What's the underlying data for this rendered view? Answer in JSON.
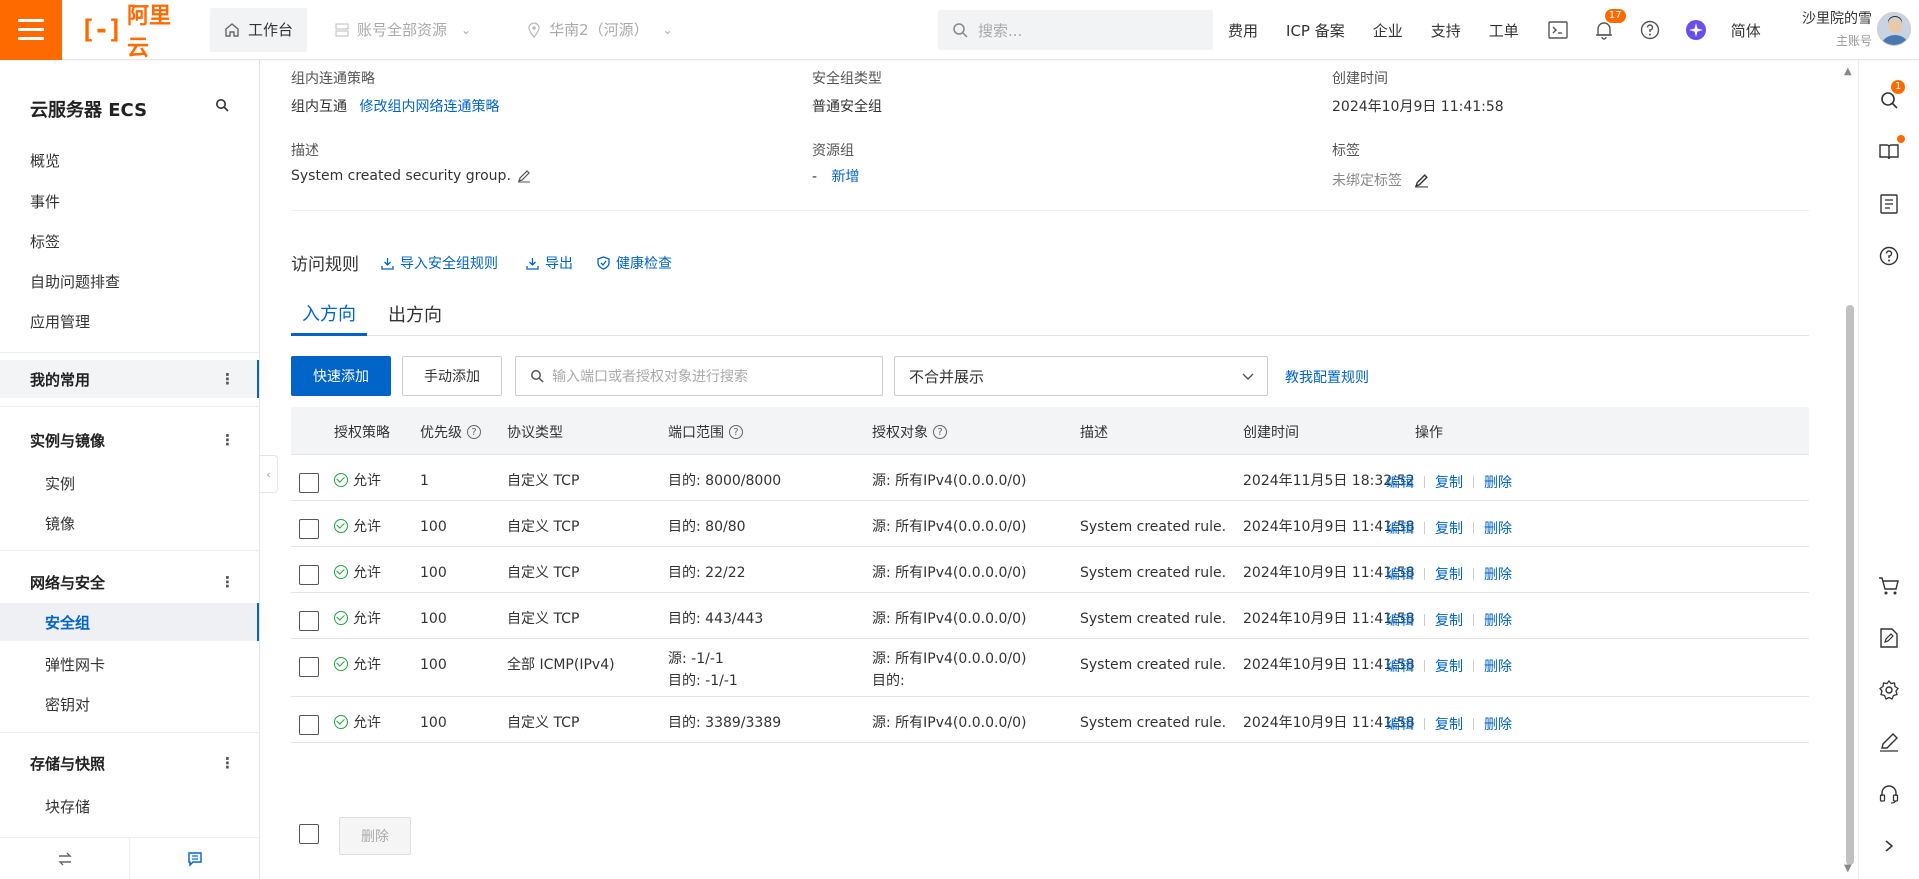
{
  "topbar": {
    "logo_text": "阿里云",
    "workbench": "工作台",
    "account_resources": "账号全部资源",
    "region": "华南2（河源）",
    "search_placeholder": "搜索...",
    "nav": [
      "费用",
      "ICP 备案",
      "企业",
      "支持",
      "工单"
    ],
    "notification_count": "17",
    "language": "简体",
    "username": "沙里院的雪",
    "account_type": "主账号"
  },
  "sidebar": {
    "title": "云服务器 ECS",
    "top_items": [
      "概览",
      "事件",
      "标签",
      "自助问题排查",
      "应用管理"
    ],
    "groups": {
      "favorites": "我的常用",
      "instances_images": {
        "label": "实例与镜像",
        "items": [
          "实例",
          "镜像"
        ]
      },
      "network_security": {
        "label": "网络与安全",
        "selected": "安全组",
        "items": [
          "弹性网卡",
          "密钥对"
        ]
      },
      "storage_snapshot": {
        "label": "存储与快照",
        "items": [
          "块存储"
        ]
      }
    }
  },
  "info": {
    "policy_label": "组内连通策略",
    "policy_value": "组内互通",
    "policy_link": "修改组内网络连通策略",
    "type_label": "安全组类型",
    "type_value": "普通安全组",
    "created_label": "创建时间",
    "created_value": "2024年10月9日 11:41:58",
    "desc_label": "描述",
    "desc_value": "System created security group.",
    "rg_label": "资源组",
    "rg_value": "-",
    "rg_link": "新增",
    "tags_label": "标签",
    "tags_value": "未绑定标签"
  },
  "rules": {
    "title": "访问规则",
    "actions": [
      "导入安全组规则",
      "导出",
      "健康检查"
    ],
    "tabs": [
      "入方向",
      "出方向"
    ],
    "quick_add": "快速添加",
    "manual_add": "手动添加",
    "search_placeholder": "输入端口或者授权对象进行搜索",
    "display_mode": "不合并展示",
    "help_link": "教我配置规则",
    "columns": [
      "授权策略",
      "优先级",
      "协议类型",
      "端口范围",
      "授权对象",
      "描述",
      "创建时间",
      "操作"
    ],
    "ops": [
      "编辑",
      "复制",
      "删除"
    ],
    "rows": [
      {
        "policy": "允许",
        "priority": "1",
        "protocol": "自定义 TCP",
        "port": "目的: 8000/8000",
        "port2": "",
        "object": "源: 所有IPv4(0.0.0.0/0)",
        "object2": "",
        "desc": "",
        "created": "2024年11月5日 18:32:52"
      },
      {
        "policy": "允许",
        "priority": "100",
        "protocol": "自定义 TCP",
        "port": "目的: 80/80",
        "port2": "",
        "object": "源: 所有IPv4(0.0.0.0/0)",
        "object2": "",
        "desc": "System created rule.",
        "created": "2024年10月9日 11:41:58"
      },
      {
        "policy": "允许",
        "priority": "100",
        "protocol": "自定义 TCP",
        "port": "目的: 22/22",
        "port2": "",
        "object": "源: 所有IPv4(0.0.0.0/0)",
        "object2": "",
        "desc": "System created rule.",
        "created": "2024年10月9日 11:41:58"
      },
      {
        "policy": "允许",
        "priority": "100",
        "protocol": "自定义 TCP",
        "port": "目的: 443/443",
        "port2": "",
        "object": "源: 所有IPv4(0.0.0.0/0)",
        "object2": "",
        "desc": "System created rule.",
        "created": "2024年10月9日 11:41:58"
      },
      {
        "policy": "允许",
        "priority": "100",
        "protocol": "全部 ICMP(IPv4)",
        "port": "源: -1/-1",
        "port2": "目的: -1/-1",
        "object": "源: 所有IPv4(0.0.0.0/0)",
        "object2": "目的:",
        "desc": "System created rule.",
        "created": "2024年10月9日 11:41:58"
      },
      {
        "policy": "允许",
        "priority": "100",
        "protocol": "自定义 TCP",
        "port": "目的: 3389/3389",
        "port2": "",
        "object": "源: 所有IPv4(0.0.0.0/0)",
        "object2": "",
        "desc": "System created rule.",
        "created": "2024年10月9日 11:41:58"
      }
    ],
    "bulk_delete": "删除"
  },
  "right_rail": {
    "search_badge": "1"
  },
  "colors": {
    "brand": "#ff6a00",
    "primary": "#0064c8",
    "success": "#1ea63a"
  }
}
